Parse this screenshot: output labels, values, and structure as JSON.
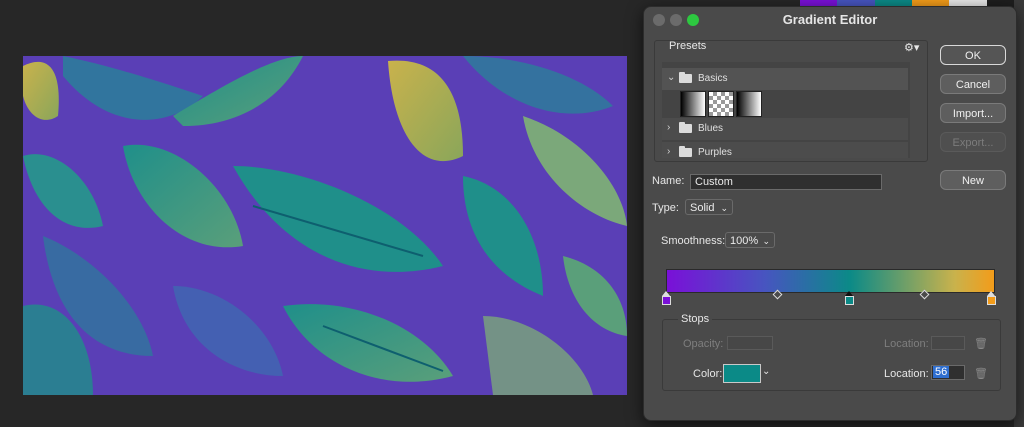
{
  "app": {
    "swatch_colors": [
      "#7a10d8",
      "#4755c0",
      "#0b8a87",
      "#f39c1a",
      "#e8e8e8",
      "#1e1e1e",
      "#1e1e1e"
    ]
  },
  "dialog": {
    "title": "Gradient Editor",
    "buttons": {
      "ok": "OK",
      "cancel": "Cancel",
      "import": "Import...",
      "export": "Export...",
      "new": "New"
    },
    "presets": {
      "label": "Presets",
      "gear_icon": "gear-icon",
      "folders": [
        {
          "name": "Basics",
          "expanded": true
        },
        {
          "name": "Blues",
          "expanded": false
        },
        {
          "name": "Purples",
          "expanded": false
        }
      ]
    },
    "name": {
      "label": "Name:",
      "value": "Custom"
    },
    "type": {
      "label": "Type:",
      "value": "Solid"
    },
    "smoothness": {
      "label": "Smoothness:",
      "value": "100%"
    },
    "gradient": {
      "stops": [
        {
          "color": "#7a10d8",
          "location": 0
        },
        {
          "color": "#0b8a87",
          "location": 56,
          "selected": true
        },
        {
          "color": "#f39c1a",
          "location": 100
        }
      ],
      "midpoints": [
        33,
        79
      ]
    },
    "stops_panel": {
      "label": "Stops",
      "opacity_label": "Opacity:",
      "opacity_location_label": "Location:",
      "color_label": "Color:",
      "color_value": "#0b8a87",
      "color_location_label": "Location:",
      "color_location_value": "56"
    }
  }
}
